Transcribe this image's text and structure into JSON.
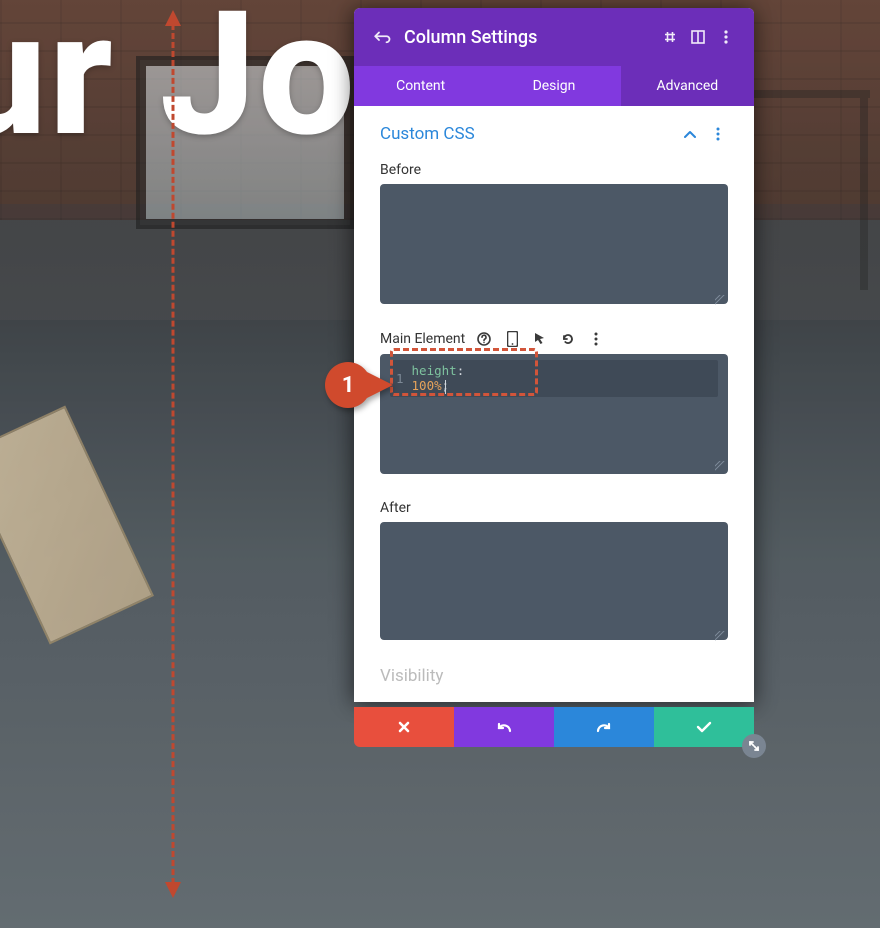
{
  "hero_text": "ur Jo",
  "panel": {
    "title": "Column Settings",
    "tabs": {
      "content": "Content",
      "design": "Design",
      "advanced": "Advanced",
      "active": "advanced"
    }
  },
  "section": {
    "title": "Custom CSS",
    "fields": {
      "before": {
        "label": "Before",
        "value": ""
      },
      "main": {
        "label": "Main Element",
        "line_number": "1",
        "tokens": {
          "key": "height",
          "colon": ":",
          "value": "100%",
          "semi": ";"
        }
      },
      "after": {
        "label": "After",
        "value": ""
      }
    },
    "next_title": "Visibility"
  },
  "step_marker": {
    "number": "1"
  },
  "icons": {
    "back": "back-arrow-icon",
    "draggable": "draggable-icon",
    "expand": "expand-icon",
    "more": "more-icon",
    "chevron_up": "chevron-up-icon",
    "help": "help-icon",
    "mobile": "mobile-icon",
    "pointer": "pointer-icon",
    "reset": "reset-icon",
    "cancel": "close-icon",
    "undo": "undo-icon",
    "redo": "redo-icon",
    "save": "check-icon",
    "resize": "resize-icon"
  }
}
